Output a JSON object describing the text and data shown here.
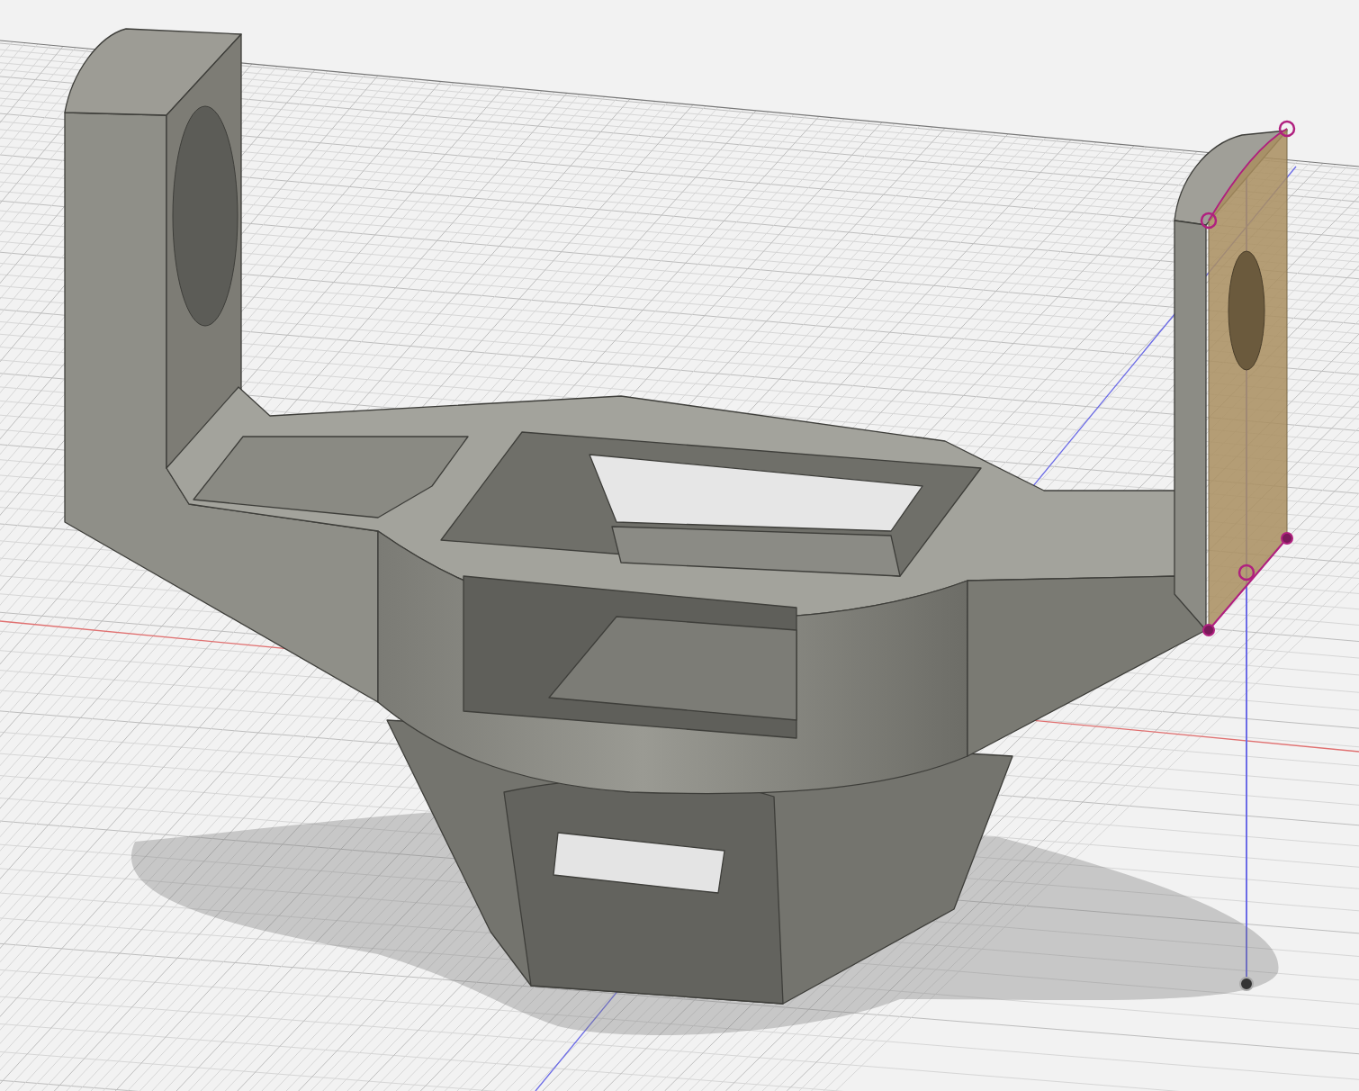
{
  "axes": [
    {
      "color": "#e07070"
    },
    {
      "color": "#6b6be6"
    },
    {
      "color": "#6b6be6"
    }
  ],
  "sketch_points": [
    {
      "kind": "hollow"
    },
    {
      "kind": "hollow"
    },
    {
      "kind": "hollow"
    },
    {
      "kind": "filled"
    },
    {
      "kind": "filled"
    }
  ],
  "origin": {
    "kind": "filled"
  }
}
